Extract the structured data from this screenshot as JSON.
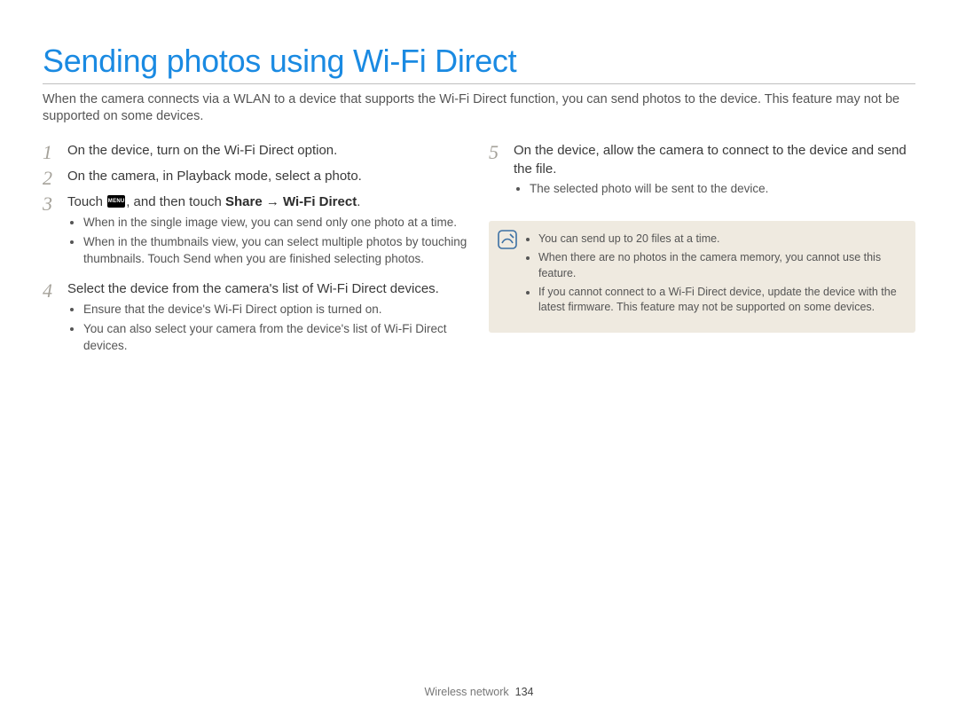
{
  "title": "Sending photos using Wi-Fi Direct",
  "intro": "When the camera connects via a WLAN to a device that supports the Wi-Fi Direct function, you can send photos to the device. This feature may not be supported on some devices.",
  "steps": {
    "s1": {
      "num": "1",
      "text": "On the device, turn on the Wi-Fi Direct option."
    },
    "s2": {
      "num": "2",
      "text": "On the camera, in Playback mode, select a photo."
    },
    "s3": {
      "num": "3",
      "lead_before": "Touch ",
      "menu_label": "MENU",
      "lead_after": ", and then touch ",
      "bold": "Share → Wi-Fi Direct",
      "dot": ".",
      "bullets": [
        "When in the single image view, you can send only one photo at a time.",
        "When in the thumbnails view, you can select multiple photos by touching thumbnails. Touch Send when you are finished selecting photos."
      ]
    },
    "s4": {
      "num": "4",
      "text": "Select the device from the camera's list of Wi-Fi Direct devices.",
      "bullets": [
        "Ensure that the device's Wi-Fi Direct option is turned on.",
        "You can also select your camera from the device's list of Wi-Fi Direct devices."
      ]
    },
    "s5": {
      "num": "5",
      "text": "On the device, allow the camera to connect to the device and send the file.",
      "bullets": [
        "The selected photo will be sent to the device."
      ]
    }
  },
  "notes": [
    "You can send up to 20 files at a time.",
    "When there are no photos in the camera memory, you cannot use this feature.",
    "If you cannot connect to a Wi-Fi Direct device, update the device with the latest firmware. This feature may not be supported on some devices."
  ],
  "footer_section": "Wireless network",
  "footer_page": "134"
}
